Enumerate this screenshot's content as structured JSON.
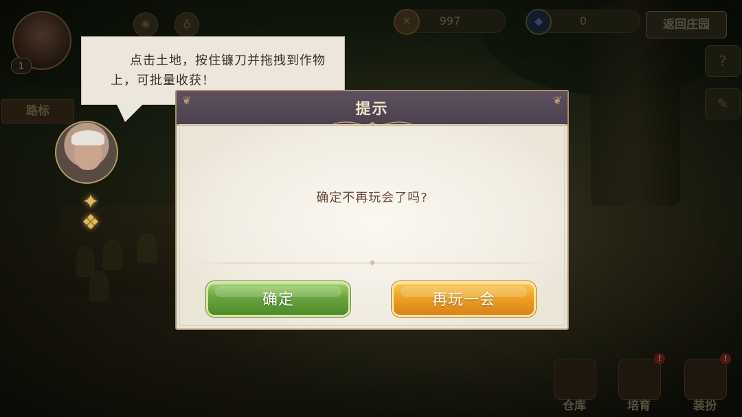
{
  "hud": {
    "player_level": "1",
    "coins": "997",
    "gems": "0",
    "return_label": "返回庄园"
  },
  "signpost_label": "路标",
  "guide": {
    "tip_text": "点击土地，按住镰刀并拖拽到作物上，可批量收获！"
  },
  "dialog": {
    "title": "提示",
    "message": "确定不再玩会了吗?",
    "confirm_label": "确定",
    "replay_label": "再玩一会"
  },
  "bottom_menu": [
    {
      "label": "仓库",
      "alert": ""
    },
    {
      "label": "培育",
      "alert": "!"
    },
    {
      "label": "装扮",
      "alert": "!"
    }
  ],
  "colors": {
    "dialog_header": "#4c4150",
    "confirm_green": "#6aa43e",
    "replay_orange": "#eb9f22",
    "message_text": "#6a4a3c"
  }
}
